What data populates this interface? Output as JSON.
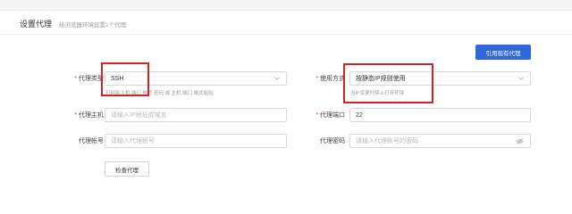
{
  "header": {
    "title": "设置代理",
    "subtitle": "给浏览器环境设置1个代理"
  },
  "use_existing_button": "引用现有代理",
  "form": {
    "proxy_type": {
      "label": "代理类型",
      "value": "SSH",
      "hint": "可粘贴主机,端口,帐号,密码 或 主机,端口 格式粘贴"
    },
    "usage_mode": {
      "label": "使用方式",
      "value": "按静态IP规则使用",
      "hint": "当IP变更时禁止打开环境"
    },
    "proxy_host": {
      "label": "代理主机",
      "placeholder": "请输入IP地址或域名"
    },
    "proxy_port": {
      "label": "代理端口",
      "value": "22"
    },
    "proxy_account": {
      "label": "代理帐号",
      "placeholder": "请输入代理帐号"
    },
    "proxy_password": {
      "label": "代理密码",
      "placeholder": "请输入代理帐号的密码"
    }
  },
  "check_button": "检查代理",
  "colors": {
    "primary": "#2f68d8",
    "required": "#e33333",
    "annotation": "#d3232a"
  }
}
